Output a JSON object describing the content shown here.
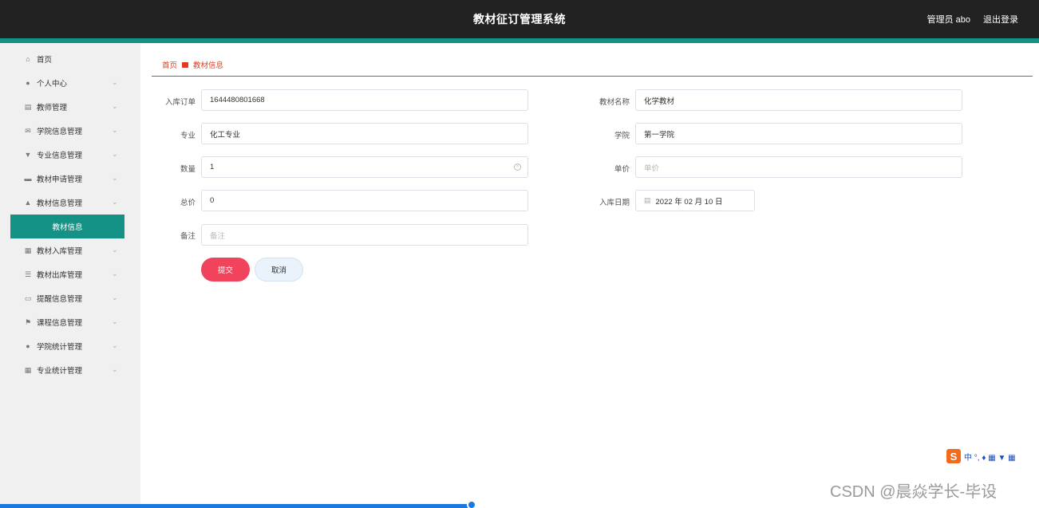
{
  "app": {
    "title": "教材征订管理系统"
  },
  "header": {
    "user": "管理员 abo",
    "logout": "退出登录"
  },
  "sidebar": {
    "items": [
      {
        "label": "首页",
        "icon": "home-icon",
        "glyph": "⌂",
        "expandable": false
      },
      {
        "label": "个人中心",
        "icon": "user-icon",
        "glyph": "●",
        "expandable": true
      },
      {
        "label": "教师管理",
        "icon": "doc-icon",
        "glyph": "▤",
        "expandable": true
      },
      {
        "label": "学院信息管理",
        "icon": "mail-icon",
        "glyph": "✉",
        "expandable": true
      },
      {
        "label": "专业信息管理",
        "icon": "trophy-icon",
        "glyph": "▼",
        "expandable": true
      },
      {
        "label": "教材申请管理",
        "icon": "chat-icon",
        "glyph": "▬",
        "expandable": true
      },
      {
        "label": "教材信息管理",
        "icon": "thumb-icon",
        "glyph": "▲",
        "expandable": true
      },
      {
        "label": "教材入库管理",
        "icon": "grid-icon",
        "glyph": "▦",
        "expandable": true
      },
      {
        "label": "教材出库管理",
        "icon": "list-icon",
        "glyph": "☰",
        "expandable": true
      },
      {
        "label": "提醒信息管理",
        "icon": "briefcase-icon",
        "glyph": "▭",
        "expandable": true
      },
      {
        "label": "课程信息管理",
        "icon": "flag-icon",
        "glyph": "⚑",
        "expandable": true
      },
      {
        "label": "学院统计管理",
        "icon": "user-icon",
        "glyph": "●",
        "expandable": true
      },
      {
        "label": "专业统计管理",
        "icon": "grid-icon",
        "glyph": "▦",
        "expandable": true
      }
    ],
    "active_sub": "教材信息",
    "chevron": "⌄"
  },
  "breadcrumb": {
    "home": "首页",
    "current": "教材信息"
  },
  "form": {
    "order_label": "入库订单",
    "order_value": "1644480801668",
    "name_label": "教材名称",
    "name_value": "化学教材",
    "major_label": "专业",
    "major_value": "化工专业",
    "college_label": "学院",
    "college_value": "第一学院",
    "qty_label": "数量",
    "qty_value": "1",
    "price_label": "单价",
    "price_placeholder": "单价",
    "total_label": "总价",
    "total_value": "0",
    "date_label": "入库日期",
    "date_value": "2022 年 02 月 10 日",
    "note_label": "备注",
    "note_placeholder": "备注",
    "submit": "提交",
    "cancel": "取消"
  },
  "ime": {
    "brand": "S",
    "items": "中 °, ♦ ▦ ▼ ▦"
  },
  "watermark": "CSDN @晨焱学长-毕设",
  "colors": {
    "accent": "#149286",
    "danger": "#f2435c",
    "topbar": "#222222",
    "breadcrumb": "#e03d20"
  }
}
